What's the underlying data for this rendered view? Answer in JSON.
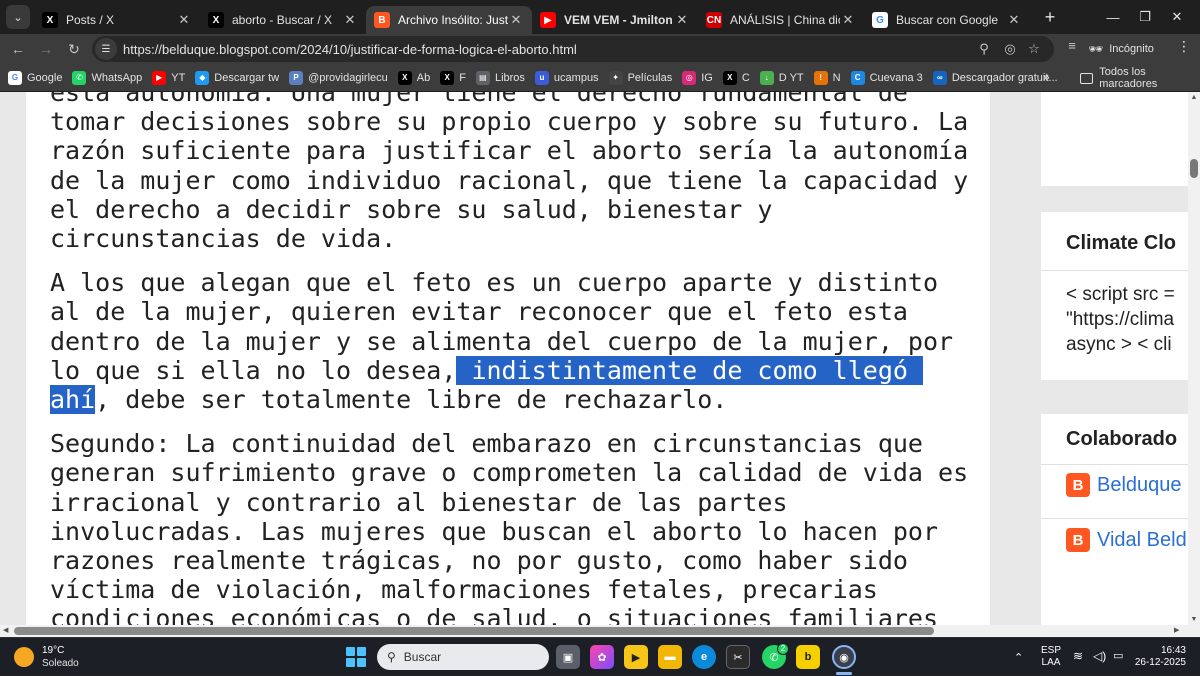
{
  "browser": {
    "tabs": [
      {
        "title": "Posts / X",
        "icon": "x-icon",
        "icon_color": "#000000",
        "icon_glyph": "X",
        "active": false
      },
      {
        "title": "aborto - Buscar / X",
        "icon": "x-icon",
        "icon_color": "#000000",
        "icon_glyph": "X",
        "active": false
      },
      {
        "title": "Archivo Insólito: Justificar d",
        "icon": "blogger-icon",
        "icon_color": "#ff5722",
        "icon_glyph": "B",
        "active": true
      },
      {
        "title": "VEM VEM - Jmilton | SLOW",
        "icon": "youtube-icon",
        "icon_color": "#ff0000",
        "icon_glyph": "▶",
        "active": false
      },
      {
        "title": "ANÁLISIS | China dice que",
        "icon": "cnn-icon",
        "icon_color": "#cc0000",
        "icon_glyph": "CN",
        "active": false
      },
      {
        "title": "Buscar con Google",
        "icon": "google-icon",
        "icon_color": "#ffffff",
        "icon_glyph": "G",
        "active": false
      }
    ],
    "url": "https://belduque.blogspot.com/2024/10/justificar-de-forma-logica-el-aborto.html",
    "incognito_label": "Incógnito",
    "bookmarks": [
      {
        "label": "Google",
        "icon": "google-icon",
        "color": "#ffffff",
        "glyph": "G"
      },
      {
        "label": "WhatsApp",
        "icon": "whatsapp-icon",
        "color": "#25d366",
        "glyph": "✆"
      },
      {
        "label": "YT",
        "icon": "youtube-icon",
        "color": "#ff0000",
        "glyph": "▶"
      },
      {
        "label": "Descargar tw",
        "icon": "download-icon",
        "color": "#1d9bf0",
        "glyph": "◆"
      },
      {
        "label": "@providagirlecu",
        "icon": "profile-icon",
        "color": "#5b7fbf",
        "glyph": "P"
      },
      {
        "label": "Ab",
        "icon": "x-icon",
        "color": "#000000",
        "glyph": "X"
      },
      {
        "label": "F",
        "icon": "x-icon",
        "color": "#000000",
        "glyph": "X"
      },
      {
        "label": "Libros",
        "icon": "book-icon",
        "color": "#5f6368",
        "glyph": "▤"
      },
      {
        "label": "ucampus",
        "icon": "ucampus-icon",
        "color": "#3b5bdb",
        "glyph": "u"
      },
      {
        "label": "Películas",
        "icon": "film-icon",
        "color": "#444444",
        "glyph": "✦"
      },
      {
        "label": "IG",
        "icon": "instagram-icon",
        "color": "#d62976",
        "glyph": "◎"
      },
      {
        "label": "C",
        "icon": "x-icon",
        "color": "#000000",
        "glyph": "X"
      },
      {
        "label": "D YT",
        "icon": "download-icon",
        "color": "#4caf50",
        "glyph": "↓"
      },
      {
        "label": "N",
        "icon": "pin-icon",
        "color": "#e8710a",
        "glyph": "!"
      },
      {
        "label": "Cuevana 3",
        "icon": "cuevana-icon",
        "color": "#1e88e5",
        "glyph": "C"
      },
      {
        "label": "Descargador gratuit...",
        "icon": "downloader-icon",
        "color": "#1565c0",
        "glyph": "∞"
      }
    ],
    "all_bookmarks_label": "Todos los marcadores"
  },
  "article": {
    "paragraphs": [
      {
        "lines": [
          "esta autonomía. Una mujer tiene el derecho fundamental de",
          "tomar decisiones sobre su propio cuerpo y sobre su futuro. La",
          "razón suficiente para justificar el aborto sería la autonomía",
          "de la mujer como individuo racional, que tiene la capacidad y",
          "el derecho a decidir sobre su salud, bienestar y",
          "circunstancias de vida."
        ]
      },
      {
        "line1": "A los que alegan que el feto es un cuerpo aparte y distinto",
        "line2": "al de la mujer, quieren evitar reconocer que el feto esta",
        "line3": "dentro de la mujer y se alimenta del cuerpo de la mujer, por",
        "line4_pre": "lo que si ella no lo desea,",
        "line4_sel": " indistintamente de como llegó ",
        "line5_sel": "ahí",
        "line5_post": ", debe ser totalmente libre de rechazarlo."
      },
      {
        "lines": [
          "Segundo: La continuidad del embarazo en circunstancias que",
          "generan sufrimiento grave o comprometen la calidad de vida es",
          "irracional y contrario al bienestar de las partes",
          "involucradas. Las mujeres que buscan el aborto lo hacen por",
          "razones realmente trágicas, no por gusto, como haber sido",
          "víctima de violación, malformaciones fetales, precarias",
          "condiciones económicas o de salud, o situaciones familiares"
        ]
      }
    ]
  },
  "sidebar": {
    "climate_title": "Climate Clo",
    "climate_code": [
      "< script src =",
      "\"https://clima",
      "async > < cli"
    ],
    "collab_title": "Colaborado",
    "collaborators": [
      "Belduque",
      "Vidal Beld"
    ]
  },
  "taskbar": {
    "temp": "19°C",
    "condition": "Soleado",
    "search_placeholder": "Buscar",
    "lang1": "ESP",
    "lang2": "LAA",
    "time": "16:43",
    "date": "26-12-2025",
    "whatsapp_badge": "2"
  }
}
